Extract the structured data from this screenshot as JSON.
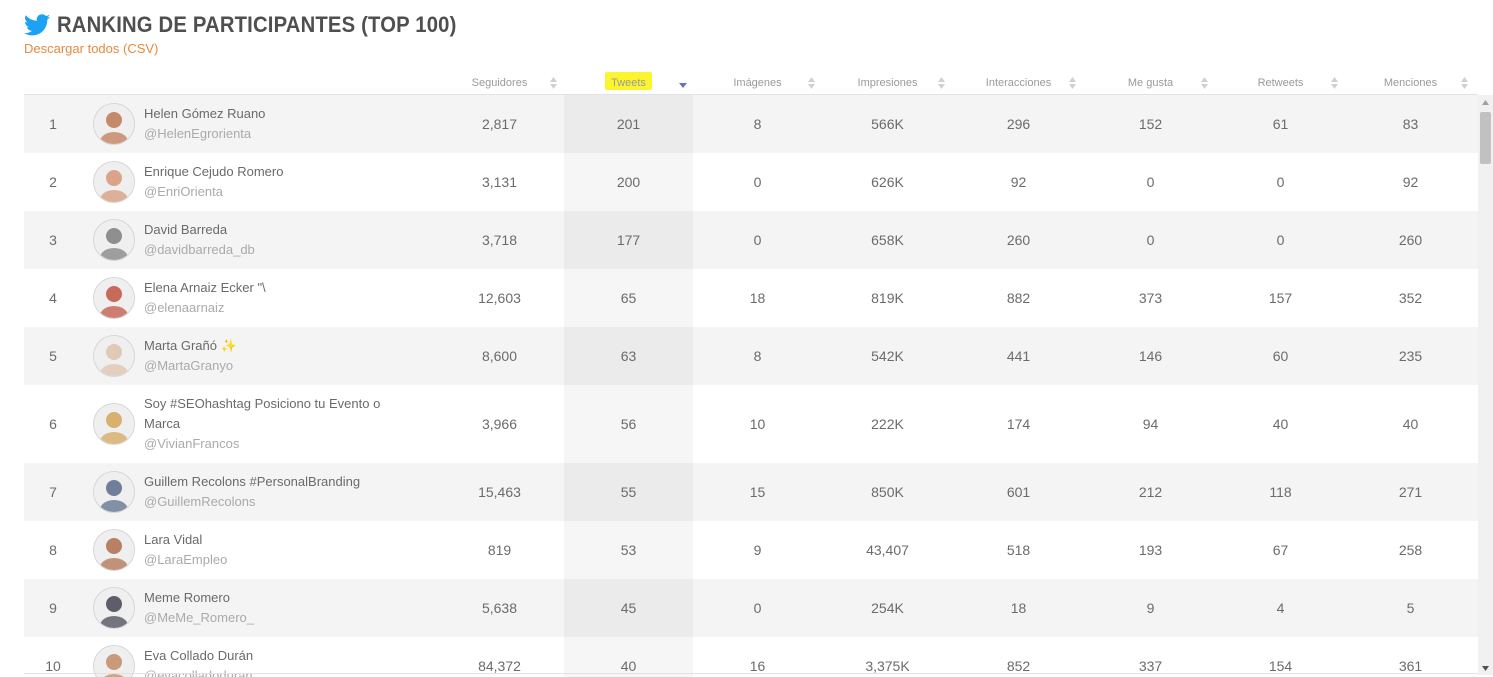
{
  "header": {
    "title": "RANKING DE PARTICIPANTES (TOP 100)",
    "csv_link": "Descargar todos (CSV)",
    "brand_color": "#1da1f2",
    "link_color": "#e8893b"
  },
  "columns": [
    {
      "key": "seguidores",
      "label": "Seguidores"
    },
    {
      "key": "tweets",
      "label": "Tweets",
      "sorted": "desc",
      "highlighted": true
    },
    {
      "key": "imagenes",
      "label": "Imágenes"
    },
    {
      "key": "impresiones",
      "label": "Impresiones"
    },
    {
      "key": "interacciones",
      "label": "Interacciones"
    },
    {
      "key": "megusta",
      "label": "Me gusta"
    },
    {
      "key": "retweets",
      "label": "Retweets"
    },
    {
      "key": "menciones",
      "label": "Menciones"
    }
  ],
  "rows": [
    {
      "rank": "1",
      "name": "Helen Gómez Ruano",
      "handle": "@HelenEgrorienta",
      "seguidores": "2,817",
      "tweets": "201",
      "imagenes": "8",
      "impresiones": "566K",
      "interacciones": "296",
      "megusta": "152",
      "retweets": "61",
      "menciones": "83"
    },
    {
      "rank": "2",
      "name": "Enrique Cejudo Romero",
      "handle": "@EnriOrienta",
      "seguidores": "3,131",
      "tweets": "200",
      "imagenes": "0",
      "impresiones": "626K",
      "interacciones": "92",
      "megusta": "0",
      "retweets": "0",
      "menciones": "92"
    },
    {
      "rank": "3",
      "name": "David Barreda",
      "handle": "@davidbarreda_db",
      "seguidores": "3,718",
      "tweets": "177",
      "imagenes": "0",
      "impresiones": "658K",
      "interacciones": "260",
      "megusta": "0",
      "retweets": "0",
      "menciones": "260"
    },
    {
      "rank": "4",
      "name": "Elena Arnaiz Ecker \"\\",
      "handle": "@elenaarnaiz",
      "seguidores": "12,603",
      "tweets": "65",
      "imagenes": "18",
      "impresiones": "819K",
      "interacciones": "882",
      "megusta": "373",
      "retweets": "157",
      "menciones": "352"
    },
    {
      "rank": "5",
      "name": "Marta Grañó ✨",
      "handle": "@MartaGranyo",
      "seguidores": "8,600",
      "tweets": "63",
      "imagenes": "8",
      "impresiones": "542K",
      "interacciones": "441",
      "megusta": "146",
      "retweets": "60",
      "menciones": "235"
    },
    {
      "rank": "6",
      "name": "Soy #SEOhashtag Posiciono tu Evento o Marca",
      "handle": "@VivianFrancos",
      "seguidores": "3,966",
      "tweets": "56",
      "imagenes": "10",
      "impresiones": "222K",
      "interacciones": "174",
      "megusta": "94",
      "retweets": "40",
      "menciones": "40"
    },
    {
      "rank": "7",
      "name": "Guillem Recolons #PersonalBranding",
      "handle": "@GuillemRecolons",
      "seguidores": "15,463",
      "tweets": "55",
      "imagenes": "15",
      "impresiones": "850K",
      "interacciones": "601",
      "megusta": "212",
      "retweets": "118",
      "menciones": "271"
    },
    {
      "rank": "8",
      "name": "Lara Vidal",
      "handle": "@LaraEmpleo",
      "seguidores": "819",
      "tweets": "53",
      "imagenes": "9",
      "impresiones": "43,407",
      "interacciones": "518",
      "megusta": "193",
      "retweets": "67",
      "menciones": "258"
    },
    {
      "rank": "9",
      "name": "Meme Romero",
      "handle": "@MeMe_Romero_",
      "seguidores": "5,638",
      "tweets": "45",
      "imagenes": "0",
      "impresiones": "254K",
      "interacciones": "18",
      "megusta": "9",
      "retweets": "4",
      "menciones": "5"
    },
    {
      "rank": "10",
      "name": "Eva Collado Durán",
      "handle": "@evacolladoduran",
      "seguidores": "84,372",
      "tweets": "40",
      "imagenes": "16",
      "impresiones": "3,375K",
      "interacciones": "852",
      "megusta": "337",
      "retweets": "154",
      "menciones": "361"
    }
  ]
}
